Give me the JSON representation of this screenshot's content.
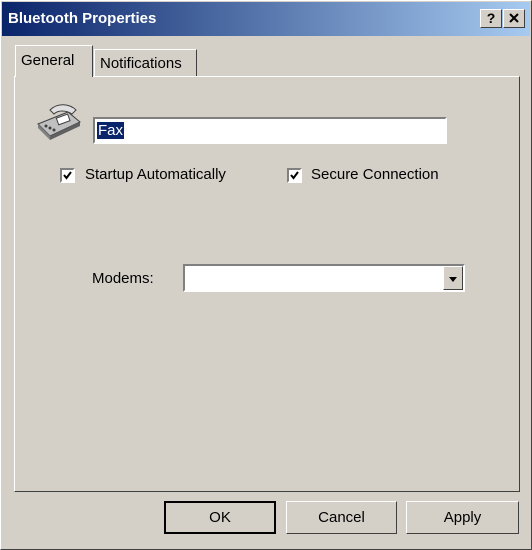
{
  "window": {
    "title": "Bluetooth Properties",
    "help_button": "?",
    "close_button": "×"
  },
  "tabs": [
    {
      "label": "General"
    },
    {
      "label": "Notifications"
    }
  ],
  "general": {
    "icon": "fax-icon",
    "name_value": "Fax",
    "startup_automatically": {
      "label": "Startup Automatically",
      "checked": true
    },
    "secure_connection": {
      "label": "Secure Connection",
      "checked": true
    },
    "modems": {
      "label": "Modems:",
      "value": ""
    }
  },
  "buttons": {
    "ok": "OK",
    "cancel": "Cancel",
    "apply": "Apply"
  }
}
